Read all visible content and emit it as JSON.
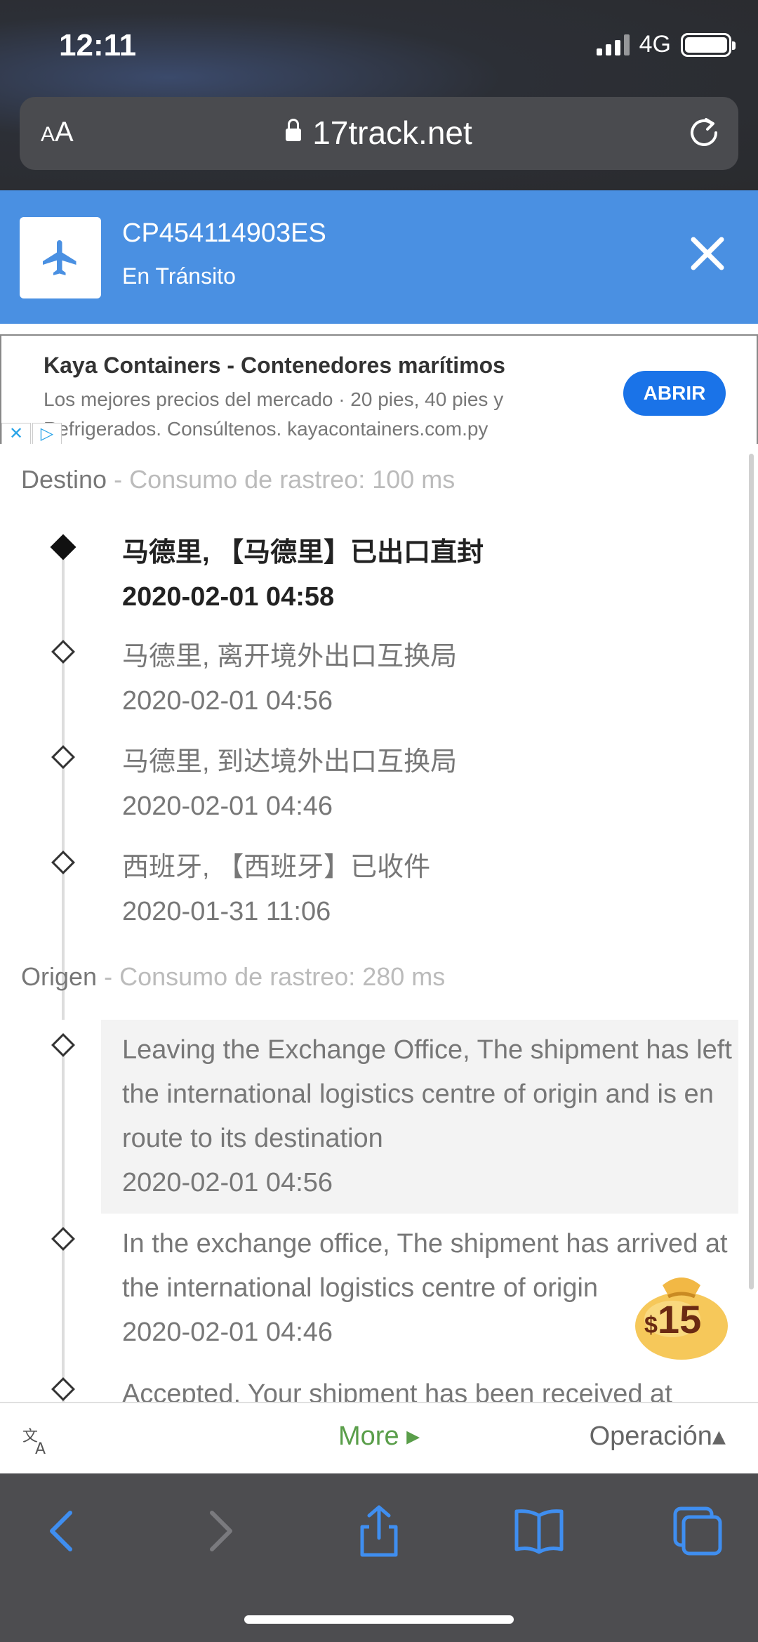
{
  "status_bar": {
    "time": "12:11",
    "network": "4G"
  },
  "browser": {
    "text_size_label": "AA",
    "url": "17track.net"
  },
  "header": {
    "tracking_number": "CP454114903ES",
    "status": "En Tránsito"
  },
  "ad": {
    "title": "Kaya Containers - Contenedores marítimos",
    "description": "Los mejores precios del mercado · 20 pies, 40 pies y Refrigerados. Consúltenos. kayacontainers.com.py",
    "button_label": "ABRIR"
  },
  "destination": {
    "label": "Destino",
    "consumption": "- Consumo de rastreo: 100 ms",
    "events": [
      {
        "text": "马德里, 【马德里】已出口直封",
        "time": "2020-02-01 04:58"
      },
      {
        "text": "马德里, 离开境外出口互换局",
        "time": "2020-02-01 04:56"
      },
      {
        "text": "马德里, 到达境外出口互换局",
        "time": "2020-02-01 04:46"
      },
      {
        "text": "西班牙, 【西班牙】已收件",
        "time": "2020-01-31 11:06"
      }
    ]
  },
  "origin": {
    "label": "Origen",
    "consumption": "- Consumo de rastreo: 280 ms",
    "events": [
      {
        "text": "Leaving the Exchange Office, The shipment has left the international logistics centre of origin and is en route to its destination",
        "time": "2020-02-01 04:56"
      },
      {
        "text": "In the exchange office, The shipment has arrived at the international logistics centre of origin",
        "time": "2020-02-01 04:46"
      },
      {
        "text": "Accepted, Your shipment has been received at",
        "time": ""
      }
    ]
  },
  "coin_badge": {
    "currency": "$",
    "amount": "15"
  },
  "action_bar": {
    "more_label": "More ▸",
    "operation_label": "Operación▴"
  },
  "icons": {
    "plane": "plane-icon",
    "close": "close-icon",
    "lock": "lock-icon",
    "reload": "reload-icon",
    "translate": "translate-icon",
    "back": "back-icon",
    "forward": "forward-icon",
    "share": "share-icon",
    "bookmarks": "book-icon",
    "tabs": "tabs-icon"
  },
  "colors": {
    "header_blue": "#4a90e2",
    "ad_button": "#1a73e8",
    "more_green": "#5a9e4a",
    "toolbar": "#4d4d50",
    "ios_blue": "#3f8ef0"
  }
}
